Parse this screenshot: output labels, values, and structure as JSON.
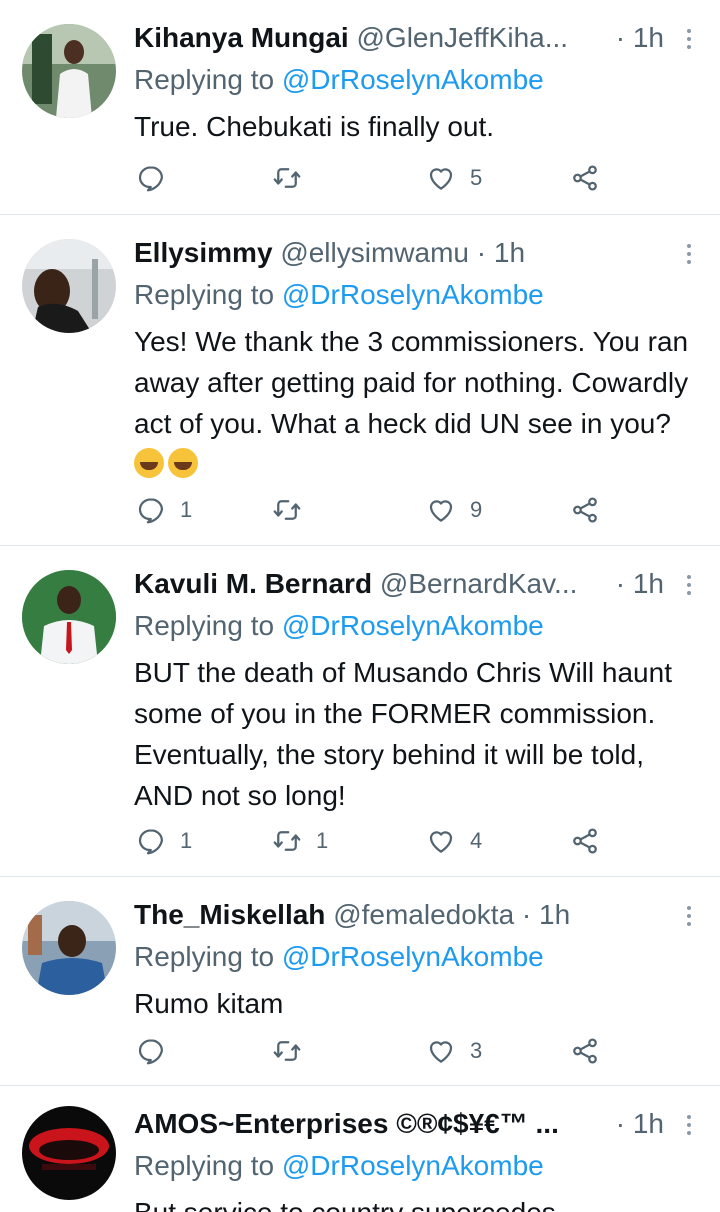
{
  "tweets": [
    {
      "name": "Kihanya Mungai",
      "handle": "@GlenJeffKiha...",
      "time": "· 1h",
      "replying_prefix": "Replying to ",
      "replying_to": "@DrRoselynAkombe",
      "text": "True. Chebukati is finally out.",
      "replies": "",
      "retweets": "",
      "likes": "5"
    },
    {
      "name": "Ellysimmy",
      "handle": "@ellysimwamu · 1h",
      "time": "",
      "replying_prefix": "Replying to ",
      "replying_to": "@DrRoselynAkombe",
      "text": "Yes! We thank the 3 commissioners. You ran away after getting paid for nothing. Cowardly act of you. What a heck did UN see in you?",
      "replies": "1",
      "retweets": "",
      "likes": "9"
    },
    {
      "name": "Kavuli M. Bernard",
      "handle": "@BernardKav...",
      "time": "· 1h",
      "replying_prefix": "Replying to ",
      "replying_to": "@DrRoselynAkombe",
      "text": "BUT the death of Musando Chris Will haunt some of you in the FORMER commission. Eventually, the story behind it will be told, AND not so long!",
      "replies": "1",
      "retweets": "1",
      "likes": "4"
    },
    {
      "name": "The_Miskellah",
      "handle": "@femaledokta · 1h",
      "time": "",
      "replying_prefix": "Replying to ",
      "replying_to": "@DrRoselynAkombe",
      "text": "Rumo kitam",
      "replies": "",
      "retweets": "",
      "likes": "3"
    },
    {
      "name": "AMOS~Enterprises ©®¢$¥€™ ...",
      "handle": "",
      "time": "· 1h",
      "replying_prefix": "Replying to ",
      "replying_to": "@DrRoselynAkombe",
      "text": "But service to country supercedes",
      "replies": "",
      "retweets": "",
      "likes": ""
    }
  ],
  "icons": {
    "reply": "reply-icon",
    "retweet": "retweet-icon",
    "like": "heart-icon",
    "share": "share-icon",
    "more": "more-icon"
  },
  "colors": {
    "link": "#1d9bf0",
    "secondary": "#536471",
    "divider": "#e1e8ed"
  }
}
